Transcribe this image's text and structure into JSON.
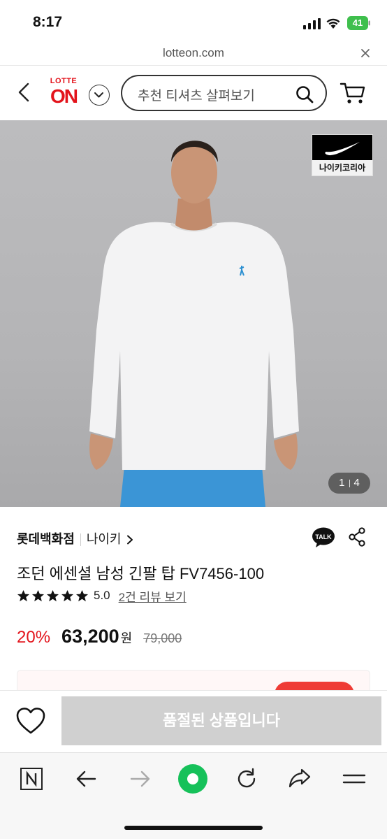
{
  "status_bar": {
    "time": "8:17",
    "battery": "41"
  },
  "url_bar": {
    "domain": "lotteon.com"
  },
  "header": {
    "logo_top": "LOTTE",
    "logo_main": "ON",
    "search_placeholder": "추천 티셔츠 살펴보기"
  },
  "gallery": {
    "brand_badge_label": "나이키코리아",
    "current": "1",
    "total": "4"
  },
  "product": {
    "seller": "롯데백화점",
    "brand": "나이키",
    "title": "조던 에센셜 남성 긴팔 탑 FV7456-100",
    "rating": "5.0",
    "stars": 5,
    "review_link": "2건 리뷰 보기",
    "discount": "20%",
    "price": "63,200",
    "price_unit": "원",
    "original_price": "79,000"
  },
  "purchase_bar": {
    "soldout_label": "품절된 상품입니다"
  },
  "colors": {
    "brand_red": "#e3141c",
    "soldout_gray": "#d0d0d0",
    "toolbar_green": "#16c15a"
  }
}
